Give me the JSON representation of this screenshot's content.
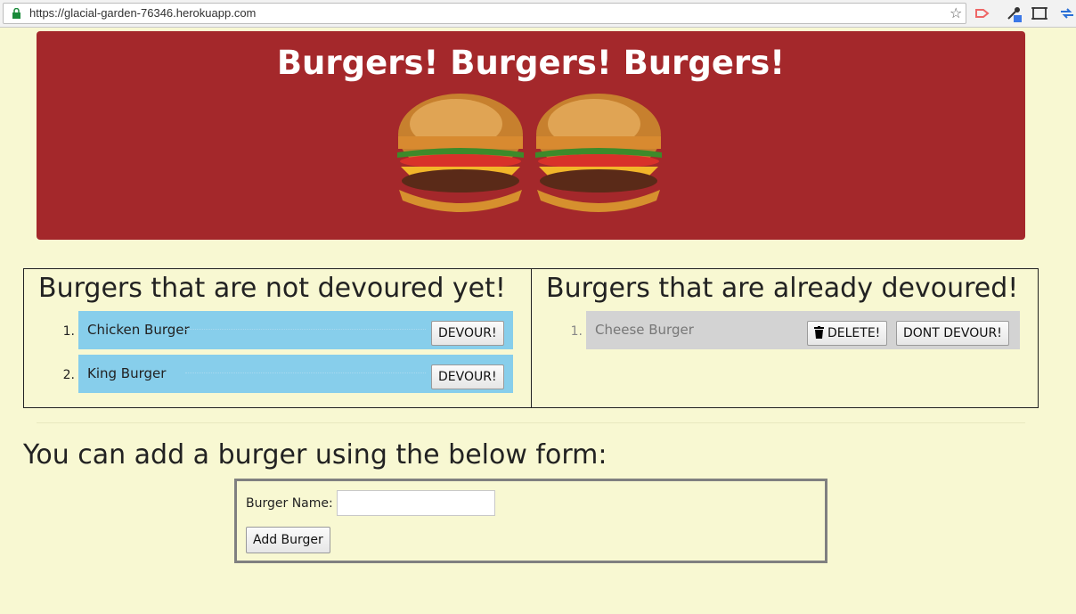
{
  "browser": {
    "url": "https://glacial-garden-76346.herokuapp.com"
  },
  "header": {
    "title": "Burgers! Burgers! Burgers!",
    "images": [
      "burger-image",
      "burger-image"
    ]
  },
  "not_devoured": {
    "heading": "Burgers that are not devoured yet!",
    "items": [
      {
        "num": "1.",
        "name": "Chicken Burger",
        "button": "DEVOUR!"
      },
      {
        "num": "2.",
        "name": "King Burger",
        "button": "DEVOUR!"
      }
    ]
  },
  "devoured": {
    "heading": "Burgers that are already devoured!",
    "items": [
      {
        "num": "1.",
        "name": "Cheese Burger",
        "delete_button": "DELETE!",
        "undo_button": "DONT DEVOUR!"
      }
    ]
  },
  "form": {
    "heading": "You can add a burger using the below form:",
    "label": "Burger Name:",
    "input_value": "",
    "submit_label": "Add Burger"
  },
  "colors": {
    "background": "#f8f8d2",
    "header_bg": "#a4282b",
    "not_devoured_row": "#87ceeb",
    "devoured_row": "#d3d3d3"
  }
}
